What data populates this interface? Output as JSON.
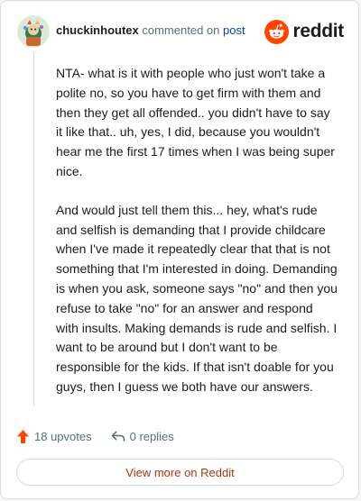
{
  "header": {
    "username": "chuckinhoutex",
    "action_text": "commented on",
    "post_link": "post",
    "brand": "reddit"
  },
  "comment": {
    "paragraphs": [
      "NTA- what is it with people who just won't take a polite no, so you have to get firm with them and then they get all offended.. you didn't have to say it like that.. uh, yes, I did, because you wouldn't hear me the first 17 times when I was being super nice.",
      "And would just tell them this... hey, what's rude and selfish is demanding that I provide childcare when I've made it repeatedly clear that that is not something that I'm interested in doing. Demanding is when you ask, someone says \"no\" and then you refuse to take \"no\" for an answer and respond with insults. Making demands is rude and selfish. I want to be around but I don't want to be responsible for the kids. If that isn't doable for you guys, then I guess we both have our answers."
    ]
  },
  "footer": {
    "upvotes": "18 upvotes",
    "replies": "0 replies",
    "view_more": "View more on Reddit"
  },
  "icons": {
    "avatar": "avatar-icon",
    "brand": "reddit-logo-icon",
    "upvote": "upvote-arrow-icon",
    "reply": "reply-arrow-icon"
  },
  "colors": {
    "brand_orange": "#ff4500",
    "link_blue": "#0a449b",
    "view_more_text": "#a23c14",
    "muted_text": "#576f76"
  }
}
